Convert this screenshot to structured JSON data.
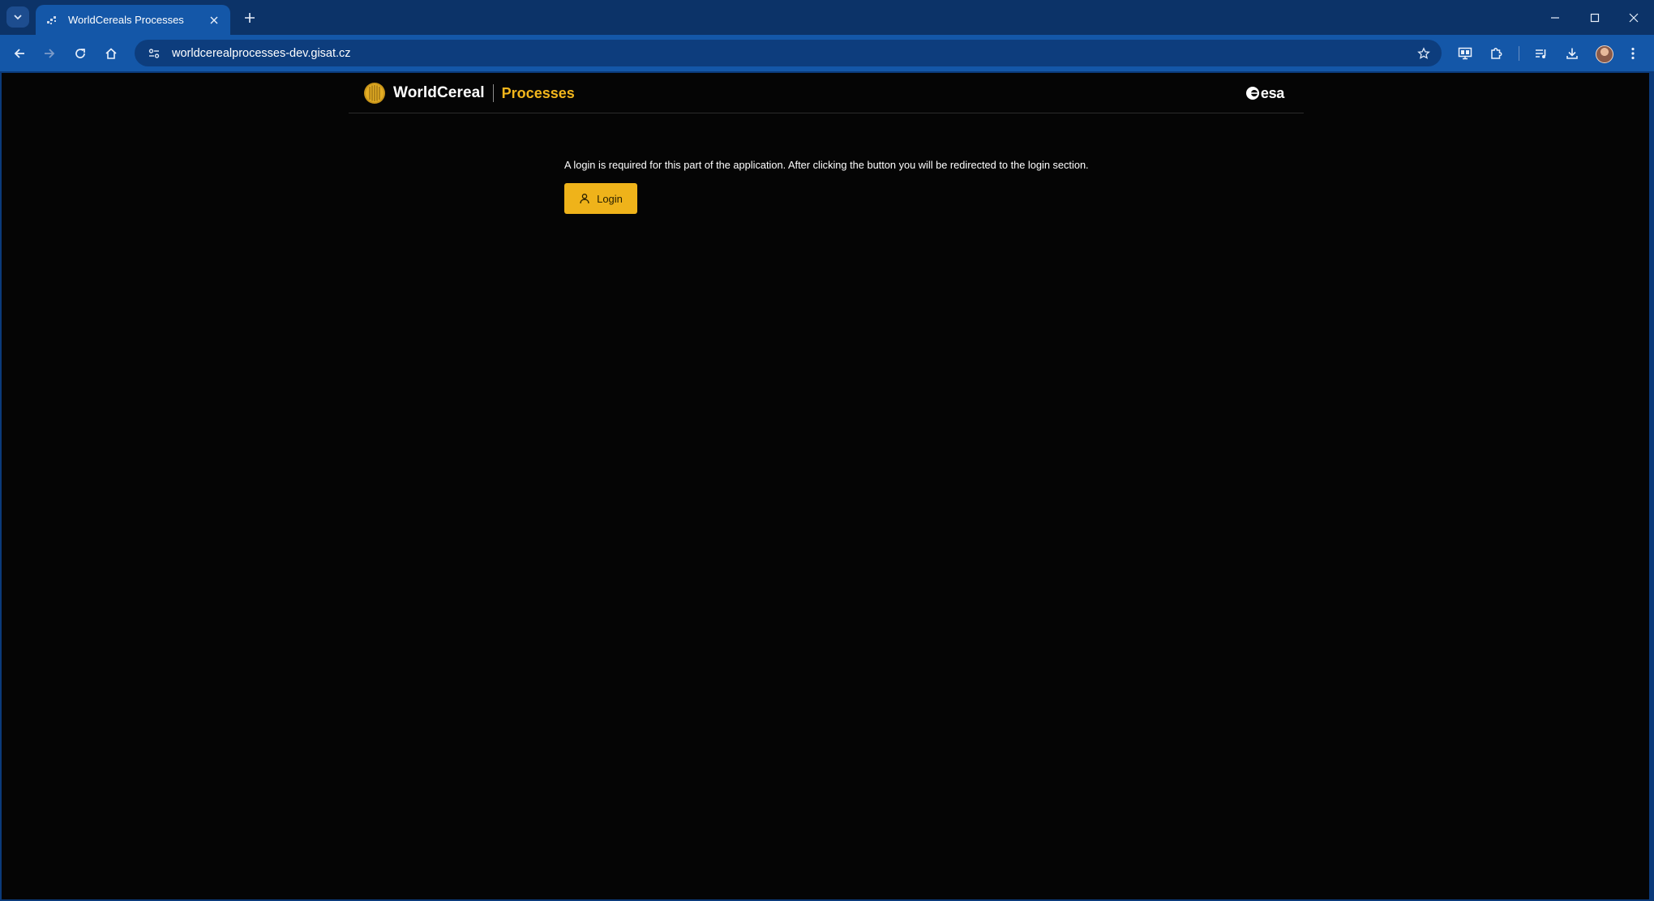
{
  "browser": {
    "tab": {
      "title": "WorldCereals Processes"
    },
    "address_bar": {
      "url": "worldcerealprocesses-dev.gisat.cz"
    }
  },
  "page": {
    "header": {
      "brand_name": "WorldCereal",
      "app_name": "Processes",
      "partner_logo_text": "esa"
    },
    "login": {
      "message": "A login is required for this part of the application. After clicking the button you will be redirected to the login section.",
      "button_label": "Login"
    }
  },
  "colors": {
    "accent": "#efb31a",
    "browser_frame": "#1457a8",
    "page_background": "#050505"
  }
}
